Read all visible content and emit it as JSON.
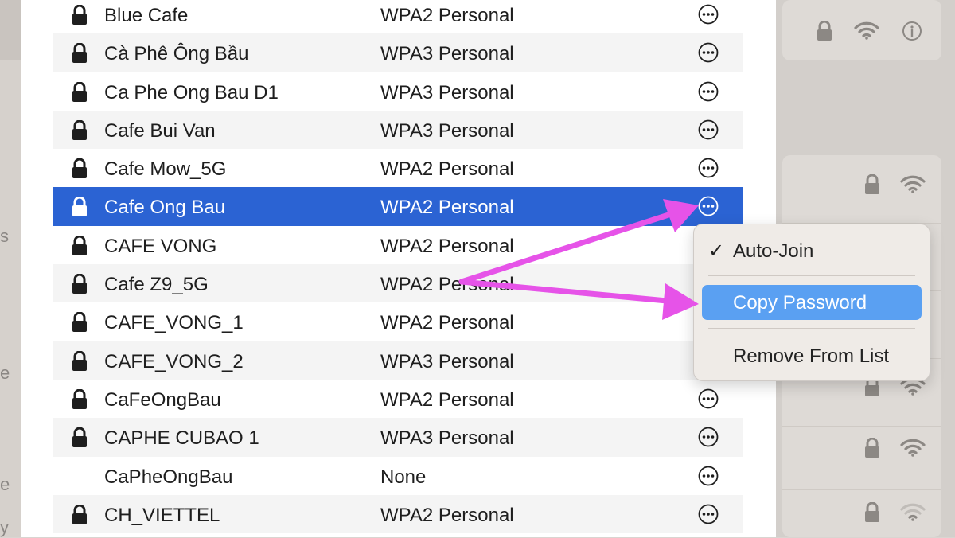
{
  "networks": [
    {
      "name": "Blue Cafe",
      "security": "WPA2 Personal",
      "locked": true,
      "more": true
    },
    {
      "name": "Cà Phê Ông Bầu",
      "security": "WPA3 Personal",
      "locked": true,
      "more": true
    },
    {
      "name": "Ca Phe Ong Bau D1",
      "security": "WPA3 Personal",
      "locked": true,
      "more": true
    },
    {
      "name": "Cafe Bui Van",
      "security": "WPA3 Personal",
      "locked": true,
      "more": true
    },
    {
      "name": "Cafe Mow_5G",
      "security": "WPA2 Personal",
      "locked": true,
      "more": true
    },
    {
      "name": "Cafe Ong Bau",
      "security": "WPA2 Personal",
      "locked": true,
      "more": true,
      "selected": true
    },
    {
      "name": "CAFE VONG",
      "security": "WPA2 Personal",
      "locked": true,
      "more": false
    },
    {
      "name": "Cafe Z9_5G",
      "security": "WPA2 Personal",
      "locked": true,
      "more": false
    },
    {
      "name": "CAFE_VONG_1",
      "security": "WPA2 Personal",
      "locked": true,
      "more": false
    },
    {
      "name": "CAFE_VONG_2",
      "security": "WPA3 Personal",
      "locked": true,
      "more": false
    },
    {
      "name": "CaFeOngBau",
      "security": "WPA2 Personal",
      "locked": true,
      "more": true
    },
    {
      "name": "CAPHE CUBAO 1",
      "security": "WPA3 Personal",
      "locked": true,
      "more": true
    },
    {
      "name": "CaPheOngBau",
      "security": "None",
      "locked": false,
      "more": true
    },
    {
      "name": "CH_VIETTEL",
      "security": "WPA2 Personal",
      "locked": true,
      "more": true
    }
  ],
  "context_menu": {
    "auto_join": {
      "check": "✓",
      "label": "Auto-Join"
    },
    "copy_password": {
      "label": "Copy Password"
    },
    "remove_from_list": {
      "label": "Remove From List"
    }
  },
  "background": {
    "left_fragments": [
      "s",
      "e",
      "e",
      "y"
    ]
  },
  "colors": {
    "selection": "#2b63d3",
    "menu_highlight": "#5aa0f2",
    "arrow": "#e653e8"
  }
}
